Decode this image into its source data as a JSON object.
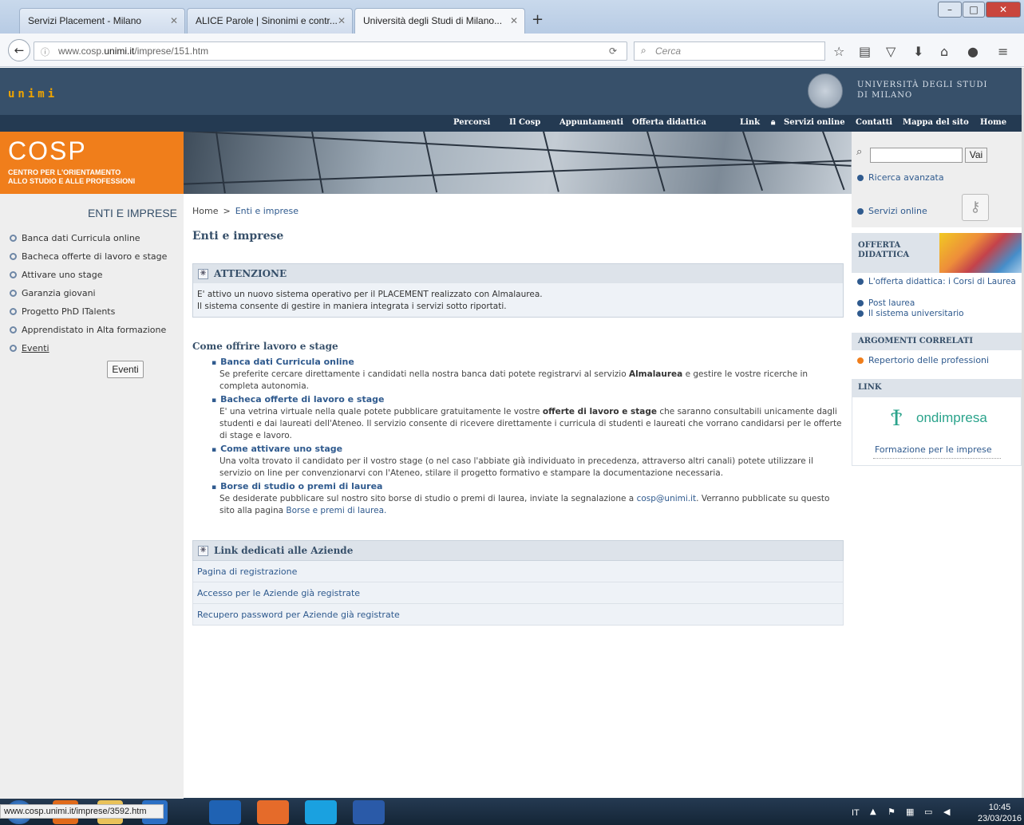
{
  "browser": {
    "tabs": [
      {
        "title": "Servizi Placement - Milano",
        "active": false
      },
      {
        "title": "ALICE Parole | Sinonimi e contr...",
        "active": false
      },
      {
        "title": "Università degli Studi di Milano...",
        "active": true
      }
    ],
    "new_tab": "+",
    "url_prefix": "www.cosp.",
    "url_domain": "unimi.it",
    "url_path": "/imprese/151.htm",
    "search_placeholder": "Cerca",
    "window_controls": {
      "minimize": "–",
      "maximize": "□",
      "close": "✕"
    }
  },
  "site": {
    "logo": "unimi",
    "university_name_line1": "UNIVERSITÀ DEGLI STUDI",
    "university_name_line2": "DI MILANO",
    "top_nav": [
      "Percorsi",
      "Il Cosp",
      "Appuntamenti",
      "Offerta didattica",
      "Link",
      "Servizi online"
    ],
    "right_nav": [
      "Contatti",
      "Mappa del sito",
      "Home"
    ],
    "cosp_title": "COSP",
    "cosp_subtitle_line1": "CENTRO PER L'ORIENTAMENTO",
    "cosp_subtitle_line2": "ALLO STUDIO E ALLE PROFESSIONI"
  },
  "left_sidebar": {
    "heading": "ENTI E IMPRESE",
    "items": [
      "Banca dati Curricula online",
      "Bacheca offerte di lavoro e stage",
      "Attivare uno stage",
      "Garanzia giovani",
      "Progetto PhD ITalents",
      "Apprendistato in Alta formazione",
      "Eventi"
    ],
    "tooltip_button": "Eventi"
  },
  "main": {
    "breadcrumb_home": "Home",
    "breadcrumb_sep": ">",
    "breadcrumb_current": "Enti e imprese",
    "title": "Enti e imprese",
    "attention_title": "ATTENZIONE",
    "attention_line1": "E' attivo un nuovo sistema operativo per il PLACEMENT realizzato con Almalaurea.",
    "attention_line2": "Il sistema consente di gestire in maniera integrata i servizi sotto riportati.",
    "section_title": "Come offrire lavoro e stage",
    "sections": [
      {
        "heading": "Banca dati Curricula online",
        "text_a": "Se preferite cercare direttamente i candidati nella nostra banca dati potete registrarvi al servizio ",
        "bold": "Almalaurea",
        "text_b": " e gestire le vostre ricerche in completa autonomia."
      },
      {
        "heading": "Bacheca offerte di lavoro e stage",
        "text_a": "E' una vetrina virtuale nella quale potete pubblicare gratuitamente le vostre ",
        "bold": "offerte di lavoro e stage",
        "text_b": " che saranno consultabili unicamente dagli studenti e dai laureati dell'Ateneo. Il servizio consente di ricevere direttamente i curricula di studenti e laureati che vorrano candidarsi per le offerte di stage e lavoro."
      },
      {
        "heading": "Come attivare uno stage",
        "text_a": "Una volta trovato il candidato per il vostro stage (o nel caso l'abbiate già individuato in precedenza, attraverso altri canali) potete utilizzare il servizio on line per convenzionarvi con l'Ateneo, stilare il progetto formativo e stampare la documentazione necessaria.",
        "bold": "",
        "text_b": ""
      },
      {
        "heading": "Borse di studio o premi di laurea",
        "text_a": "Se desiderate pubblicare sul nostro sito borse di studio o premi di laurea, inviate la segnalazione a ",
        "bold": "cosp@unimi.it",
        "text_b": ". Verranno pubblicate su questo sito alla pagina ",
        "link": "Borse e premi di laurea."
      }
    ],
    "links_title": "Link dedicati alle Aziende",
    "links": [
      "Pagina di registrazione",
      "Accesso per le Aziende già registrate",
      "Recupero password per Aziende già registrate"
    ]
  },
  "right_sidebar": {
    "search_button": "Vai",
    "advanced_search": "Ricerca avanzata",
    "online_services": "Servizi online",
    "offerta_title_line1": "OFFERTA",
    "offerta_title_line2": "DIDATTICA",
    "offerta_links": [
      "L'offerta didattica: i Corsi di Laurea",
      "Post laurea",
      "Il sistema universitario"
    ],
    "argomenti_title": "ARGOMENTI CORRELATI",
    "argomenti_link": "Repertorio delle professioni",
    "link_title": "LINK",
    "fondimpresa_logo": "ondimpresa",
    "fondimpresa_caption": "Formazione per le imprese"
  },
  "status_bar": "www.cosp.unimi.it/imprese/3592.htm",
  "taskbar": {
    "language": "IT",
    "time": "10:45",
    "date": "23/03/2016"
  }
}
